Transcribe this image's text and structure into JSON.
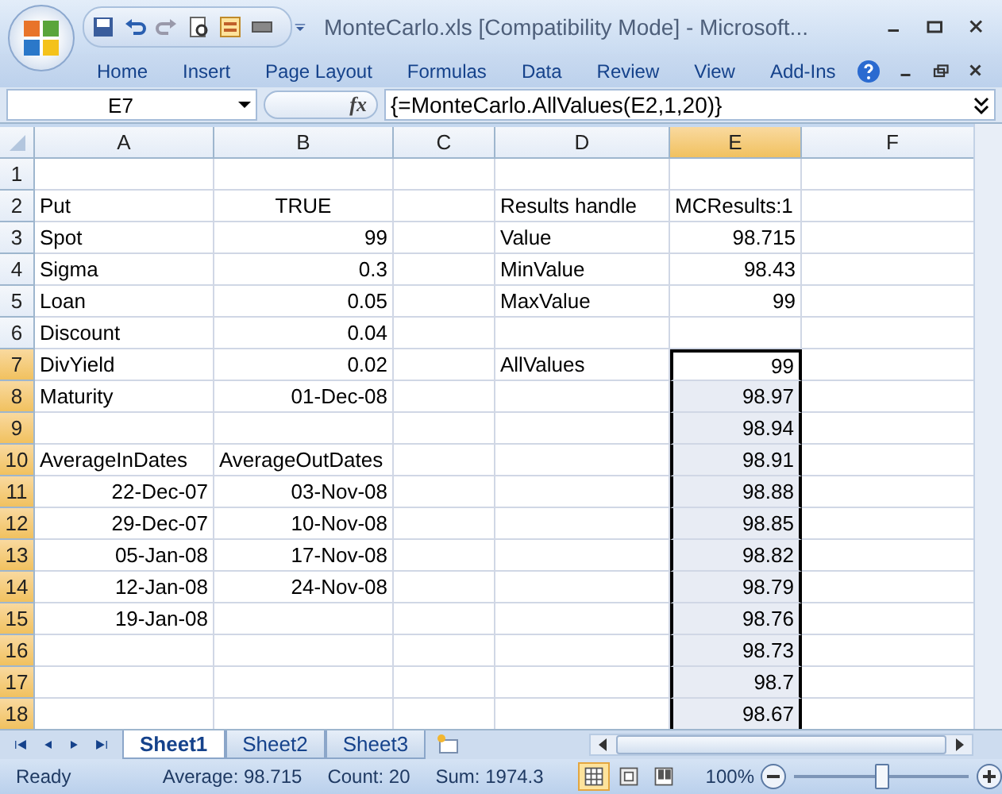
{
  "window": {
    "title": "MonteCarlo.xls  [Compatibility Mode] - Microsoft..."
  },
  "ribbon_tabs": [
    {
      "label": "Home",
      "selected": false
    },
    {
      "label": "Insert",
      "selected": false
    },
    {
      "label": "Page Layout",
      "selected": false
    },
    {
      "label": "Formulas",
      "selected": false
    },
    {
      "label": "Data",
      "selected": false
    },
    {
      "label": "Review",
      "selected": false
    },
    {
      "label": "View",
      "selected": false
    },
    {
      "label": "Add-Ins",
      "selected": false
    }
  ],
  "formula_bar": {
    "name_box": "E7",
    "fx": "fx",
    "formula": "{=MonteCarlo.AllValues(E2,1,20)}"
  },
  "columns": [
    {
      "letter": "A",
      "selected": false
    },
    {
      "letter": "B",
      "selected": false
    },
    {
      "letter": "C",
      "selected": false
    },
    {
      "letter": "D",
      "selected": false
    },
    {
      "letter": "E",
      "selected": true
    },
    {
      "letter": "F",
      "selected": false
    }
  ],
  "rows": [
    {
      "number": "1",
      "selected": false,
      "cells": {}
    },
    {
      "number": "2",
      "selected": false,
      "cells": {
        "A": {
          "value": "Put",
          "kind": "text"
        },
        "B": {
          "value": "TRUE",
          "kind": "boolean"
        },
        "D": {
          "value": "Results handle",
          "kind": "text"
        },
        "E": {
          "value": "MCResults:1",
          "kind": "text"
        }
      }
    },
    {
      "number": "3",
      "selected": false,
      "cells": {
        "A": {
          "value": "Spot",
          "kind": "text"
        },
        "B": {
          "value": "99",
          "kind": "number"
        },
        "D": {
          "value": "Value",
          "kind": "text"
        },
        "E": {
          "value": "98.715",
          "kind": "number"
        }
      }
    },
    {
      "number": "4",
      "selected": false,
      "cells": {
        "A": {
          "value": "Sigma",
          "kind": "text"
        },
        "B": {
          "value": "0.3",
          "kind": "number"
        },
        "D": {
          "value": "MinValue",
          "kind": "text"
        },
        "E": {
          "value": "98.43",
          "kind": "number"
        }
      }
    },
    {
      "number": "5",
      "selected": false,
      "cells": {
        "A": {
          "value": "Loan",
          "kind": "text"
        },
        "B": {
          "value": "0.05",
          "kind": "number"
        },
        "D": {
          "value": "MaxValue",
          "kind": "text"
        },
        "E": {
          "value": "99",
          "kind": "number"
        }
      }
    },
    {
      "number": "6",
      "selected": false,
      "cells": {
        "A": {
          "value": "Discount",
          "kind": "text"
        },
        "B": {
          "value": "0.04",
          "kind": "number"
        }
      }
    },
    {
      "number": "7",
      "selected": true,
      "cells": {
        "A": {
          "value": "DivYield",
          "kind": "text"
        },
        "B": {
          "value": "0.02",
          "kind": "number"
        },
        "D": {
          "value": "AllValues",
          "kind": "text"
        },
        "E": {
          "value": "99",
          "kind": "number",
          "selected": true,
          "active": true
        }
      }
    },
    {
      "number": "8",
      "selected": true,
      "cells": {
        "A": {
          "value": "Maturity",
          "kind": "text"
        },
        "B": {
          "value": "01-Dec-08",
          "kind": "number"
        },
        "E": {
          "value": "98.97",
          "kind": "number",
          "selected": true,
          "active": false
        }
      }
    },
    {
      "number": "9",
      "selected": true,
      "cells": {
        "E": {
          "value": "98.94",
          "kind": "number",
          "selected": true,
          "active": false
        }
      }
    },
    {
      "number": "10",
      "selected": true,
      "cells": {
        "A": {
          "value": "AverageInDates",
          "kind": "text"
        },
        "B": {
          "value": "AverageOutDates",
          "kind": "text"
        },
        "E": {
          "value": "98.91",
          "kind": "number",
          "selected": true,
          "active": false
        }
      }
    },
    {
      "number": "11",
      "selected": true,
      "cells": {
        "A": {
          "value": "22-Dec-07",
          "kind": "number"
        },
        "B": {
          "value": "03-Nov-08",
          "kind": "number"
        },
        "E": {
          "value": "98.88",
          "kind": "number",
          "selected": true,
          "active": false
        }
      }
    },
    {
      "number": "12",
      "selected": true,
      "cells": {
        "A": {
          "value": "29-Dec-07",
          "kind": "number"
        },
        "B": {
          "value": "10-Nov-08",
          "kind": "number"
        },
        "E": {
          "value": "98.85",
          "kind": "number",
          "selected": true,
          "active": false
        }
      }
    },
    {
      "number": "13",
      "selected": true,
      "cells": {
        "A": {
          "value": "05-Jan-08",
          "kind": "number"
        },
        "B": {
          "value": "17-Nov-08",
          "kind": "number"
        },
        "E": {
          "value": "98.82",
          "kind": "number",
          "selected": true,
          "active": false
        }
      }
    },
    {
      "number": "14",
      "selected": true,
      "cells": {
        "A": {
          "value": "12-Jan-08",
          "kind": "number"
        },
        "B": {
          "value": "24-Nov-08",
          "kind": "number"
        },
        "E": {
          "value": "98.79",
          "kind": "number",
          "selected": true,
          "active": false
        }
      }
    },
    {
      "number": "15",
      "selected": true,
      "cells": {
        "A": {
          "value": "19-Jan-08",
          "kind": "number"
        },
        "E": {
          "value": "98.76",
          "kind": "number",
          "selected": true,
          "active": false
        }
      }
    },
    {
      "number": "16",
      "selected": true,
      "cells": {
        "E": {
          "value": "98.73",
          "kind": "number",
          "selected": true,
          "active": false
        }
      }
    },
    {
      "number": "17",
      "selected": true,
      "cells": {
        "E": {
          "value": "98.7",
          "kind": "number",
          "selected": true,
          "active": false
        }
      }
    },
    {
      "number": "18",
      "selected": true,
      "cells": {
        "E": {
          "value": "98.67",
          "kind": "number",
          "selected": true,
          "active": false
        }
      }
    }
  ],
  "sheet_tabs": [
    {
      "label": "Sheet1",
      "selected": true
    },
    {
      "label": "Sheet2",
      "selected": false
    },
    {
      "label": "Sheet3",
      "selected": false
    }
  ],
  "status_bar": {
    "mode": "Ready",
    "average": "Average: 98.715",
    "count": "Count: 20",
    "sum": "Sum: 1974.3",
    "views": [
      {
        "kind": "normal",
        "selected": true
      },
      {
        "kind": "page-layout",
        "selected": false
      },
      {
        "kind": "page-break",
        "selected": false
      }
    ],
    "zoom": "100%",
    "zoom_level": {
      "level": 0.5
    }
  }
}
